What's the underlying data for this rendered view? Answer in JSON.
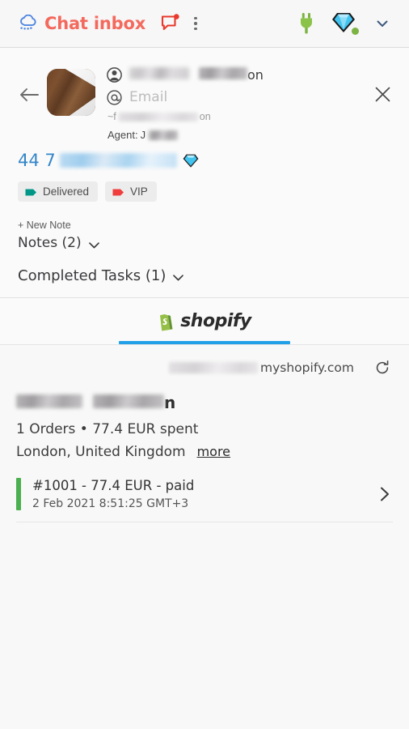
{
  "topbar": {
    "brand_title": "Chat inbox",
    "cloud_icon": "cloud-icon",
    "chat_icon": "chat-bubble-badge-icon",
    "kebab_icon": "more-vertical-icon",
    "plug_icon": "plug-connected-icon",
    "gem_icon": "diamond-icon",
    "chevron_icon": "chevron-down-icon",
    "brand_color": "#f4695d",
    "badge_color": "#e8392c",
    "plug_color": "#7cb342",
    "gem_color": "#41c4f0"
  },
  "contact": {
    "back_icon": "arrow-left-icon",
    "close_icon": "close-icon",
    "avatar_icon": "contact-avatar",
    "person_icon": "person-icon",
    "at_icon": "at-sign-icon",
    "name_suffix": "on",
    "email_placeholder": "Email",
    "handle_prefix": "~f",
    "handle_suffix": "on",
    "agent_label": "Agent:",
    "agent_value": "J",
    "phone_prefix": "44 7",
    "phone_gem_icon": "diamond-icon",
    "tags": [
      {
        "label": "Delivered",
        "color": "#009688",
        "icon": "tag-icon"
      },
      {
        "label": "VIP",
        "color": "#f03e3e",
        "icon": "tag-icon"
      }
    ],
    "new_note_label": "+ New Note",
    "notes_label": "Notes (2)",
    "tasks_label": "Completed Tasks (1)",
    "chevron_icon": "chevron-down-icon"
  },
  "tabs": {
    "active_label": "shopify",
    "active_icon": "shopify-bag-icon",
    "indicator_color": "#21a0e8"
  },
  "store": {
    "domain_suffix": "myshopify.com",
    "refresh_icon": "refresh-icon",
    "customer_name_suffix": "n",
    "orders_summary": "1 Orders • 77.4 EUR spent",
    "location": "London, United Kingdom",
    "more_label": "more",
    "orders": [
      {
        "title": "#1001 - 77.4 EUR - paid",
        "date": "2 Feb 2021 8:51:25 GMT+3",
        "status_color": "#4caf50",
        "chevron_icon": "chevron-right-icon"
      }
    ]
  }
}
